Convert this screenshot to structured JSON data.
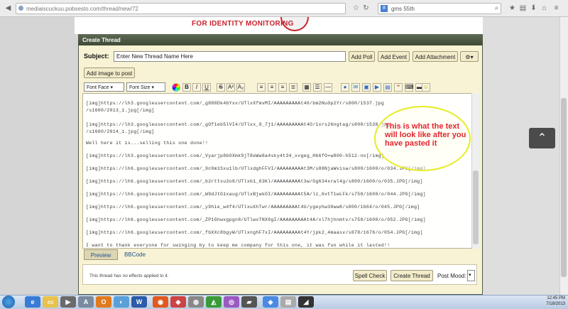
{
  "browser": {
    "url": "mediaiscuckuu.pobsesto.com/thread/new/72",
    "search_engine_label": "8",
    "search_text": "gms 55th"
  },
  "ad": {
    "text": "FOR IDENTITY MONITORING"
  },
  "thread": {
    "header": "Create Thread",
    "subject_label": "Subject:",
    "subject_value": "Enter New Thread Name Here",
    "buttons": {
      "add_poll": "Add Poll",
      "add_event": "Add Event",
      "add_attachment": "Add Attachment",
      "add_image": "Add image to post"
    },
    "toolbar": {
      "font_face": "Font Face",
      "font_size": "Font Size"
    },
    "editor_lines": [
      "[img]https://lh3.googleusercontent.com/_g888Dk4bYxx/UTlxXfmvMI/AAAAAAAAAt40/bm2Nu0p2Yr/s800/1537.jpg",
      "/s1600/2013_1.jpg[/img]",
      "[img]https://lh3.googleusercontent.com/_gOf1eb5lVI4/UTlxx_9_7j1/AAAAAAAAAt4O/1xrs26ngtag/s800/1538.jpg",
      "/s1600/2014_1.jpg[/img]",
      "Well here it is...selling this one done!!",
      "[img]https://lh3.googleusercontent.com/_Vyarjp8bOXmk9jT8eWw8a4sky4t34_xvgeg_Hb6fO=w800-h512-no[/img]",
      "[img]https://lh6.googleusercontent.com/_9c0m1Sxu1lb/UTlxdghFFVI/AAAAAAAAAt3M/s88NjaWvisw/s800/1600/o/034.JPG[/img]",
      "[img]https://lh6.googleusercontent.com/_b2rttxu3o8/UTlxb1_63Kl/AAAAAAAAAt3w/Og634xrwl4g/s800/1600/o/035.JPG[/img]",
      "[img]https://lh6.googleusercontent.com/_W9dJtG1xaug/UTlxBjwkOI/AAAAAAAAAt5A/lz_6vtT1wLFk/s758/1600/o/044.JPG[/img]",
      "[img]https://lh6.googleusercontent.com/_y9hie_w4f4/UTlxuXhTwr/AAAAAAAAAt4U/ygeyhw30ww8/s800/1664/o/045.JPG[/img]",
      "[img]https://lh6.googleusercontent.com/_ZP1Ghwxgpgn8/UTlwvTNX8gI/AAAAAAAAAt4A/xl7hjhnmtv/s758/1600/o/052.JPG[/img]",
      "[img]https://lh6.googleusercontent.com/_fbXXc8bgyW/UTlxnghF7xI/AAAAAAAAAt4Y/jpk2_4maasv/s878/1676/o/054.JPG[/img]",
      "I want to thank everyone for swinging by to keep me company for this one, it was fun while it lasted!!"
    ],
    "callout_text": "This is what the text will look like after you have pasted it",
    "tabs": {
      "preview": "Preview",
      "bbcode": "BBCode"
    },
    "footer": {
      "note": "This thread has no effects applied to it.",
      "spell_check": "Spell Check",
      "create_thread": "Create Thread",
      "post_mood": "Post Mood:"
    }
  },
  "taskbar": {
    "time": "12:45 PM",
    "date": "7/18/2013"
  },
  "colors": {
    "panel_bg": "#f7f3d4",
    "header_bg": "#4a5640",
    "callout_border": "#e6ec22",
    "callout_text": "#e2252f"
  }
}
